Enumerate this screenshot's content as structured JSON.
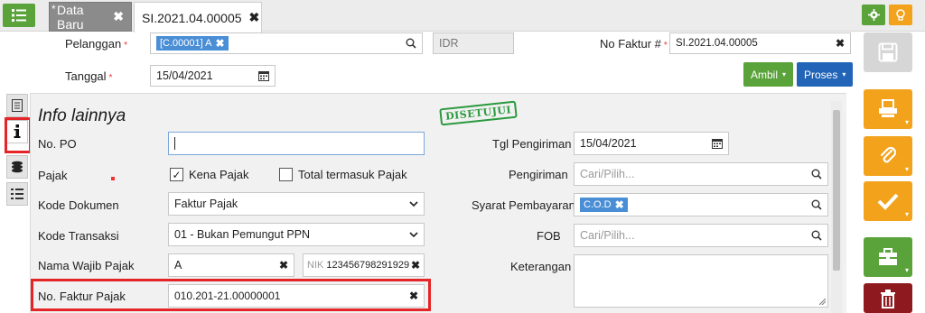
{
  "tabs": {
    "draft": {
      "star": "*",
      "label": "Data Baru",
      "close": "✖"
    },
    "active": {
      "label": "SI.2021.04.00005",
      "close": "✖"
    }
  },
  "header": {
    "pelanggan_label": "Pelanggan",
    "required_mark": "*",
    "pelanggan_value": "[C.00001] A",
    "chip_close": "✖",
    "currency": "IDR",
    "no_faktur_label": "No Faktur #",
    "no_faktur_value": "SI.2021.04.00005",
    "tanggal_label": "Tanggal",
    "tanggal_value": "15/04/2021",
    "ambil_label": "Ambil",
    "proses_label": "Proses"
  },
  "panel": {
    "title": "Info lainnya",
    "stamp": "DISETUJUI",
    "no_po_label": "No. PO",
    "no_po_value": "",
    "pajak_label": "Pajak",
    "kena_pajak_label": "Kena Pajak",
    "kena_pajak_checked": true,
    "total_termasuk_label": "Total termasuk Pajak",
    "total_termasuk_checked": false,
    "kode_dokumen_label": "Kode Dokumen",
    "kode_dokumen_value": "Faktur Pajak",
    "kode_transaksi_label": "Kode Transaksi",
    "kode_transaksi_value": "01 - Bukan Pemungut PPN",
    "nama_wajib_pajak_label": "Nama Wajib Pajak",
    "nama_wajib_pajak_value": "A",
    "nik_label": "NIK",
    "nik_value": "123456798291929",
    "no_faktur_pajak_label": "No. Faktur Pajak",
    "no_faktur_pajak_value": "010.201-21.00000001",
    "tgl_pengiriman_label": "Tgl Pengiriman",
    "tgl_pengiriman_value": "15/04/2021",
    "pengiriman_label": "Pengiriman",
    "pengiriman_placeholder": "Cari/Pilih...",
    "syarat_label": "Syarat Pembayaran",
    "syarat_value": "C.O.D",
    "fob_label": "FOB",
    "fob_placeholder": "Cari/Pilih...",
    "keterangan_label": "Keterangan",
    "keterangan_value": ""
  },
  "icons": {
    "clear": "✖",
    "checkmark": "✓",
    "caret": "▾",
    "select_arrow": "⌄"
  },
  "colors": {
    "green": "#5aa33b",
    "blue": "#2164b8",
    "orange": "#f2a21b",
    "darkred": "#8e1a1f",
    "highlight": "#e52427"
  }
}
